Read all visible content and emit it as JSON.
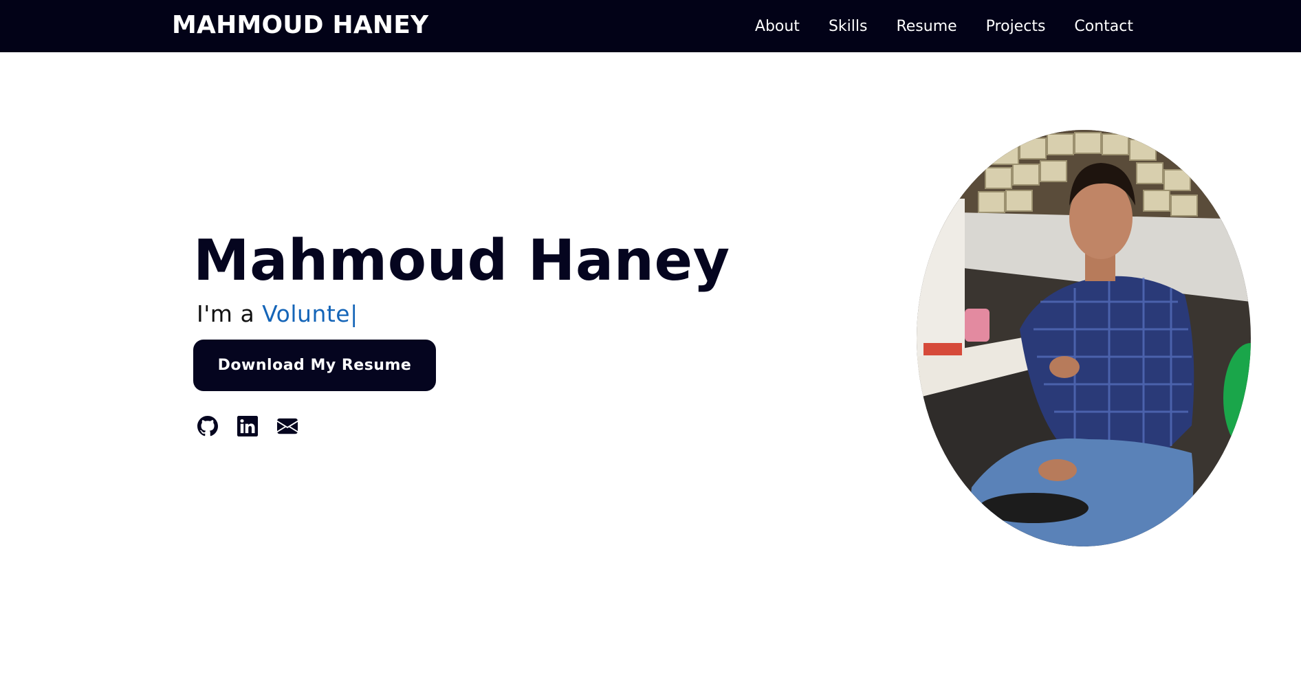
{
  "navbar": {
    "brand": "MAHMOUD HANEY",
    "links": [
      {
        "label": "About"
      },
      {
        "label": "Skills"
      },
      {
        "label": "Resume"
      },
      {
        "label": "Projects"
      },
      {
        "label": "Contact"
      }
    ]
  },
  "hero": {
    "name": "Mahmoud Haney",
    "tagline_prefix": "I'm a ",
    "typed_text": "Volunte",
    "cursor": "|",
    "resume_button_label": "Download My Resume",
    "socials": [
      {
        "icon": "github-icon"
      },
      {
        "icon": "linkedin-icon"
      },
      {
        "icon": "envelope-icon"
      }
    ]
  },
  "colors": {
    "navbar_bg": "#020217",
    "text_dark": "#05051f",
    "accent_blue": "#1565b8",
    "background": "#ffffff"
  }
}
